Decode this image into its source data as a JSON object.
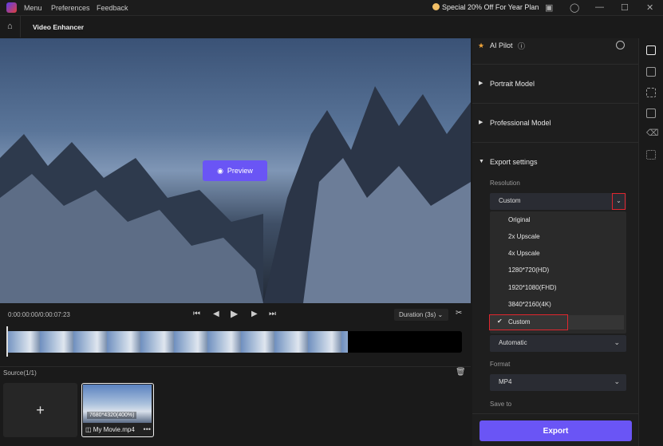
{
  "topbar": {
    "menu": "Menu",
    "preferences": "Preferences",
    "feedback": "Feedback",
    "promo": "Special 20% Off For Year Plan"
  },
  "header": {
    "title": "Video Enhancer"
  },
  "preview": {
    "label": "Preview"
  },
  "player": {
    "time": "0:00:00:00/0:00:07:23",
    "duration": "Duration (3s)"
  },
  "source": {
    "label": "Source(1/1)",
    "add": "+",
    "file": {
      "resolution": "7680*4320(400%)",
      "name": "My Movie.mp4"
    }
  },
  "panel": {
    "ai_pilot": "AI Pilot",
    "portrait": "Portrait Model",
    "professional": "Professional Model",
    "export_settings": "Export settings",
    "resolution_label": "Resolution",
    "resolution_value": "Custom",
    "resolution_options": [
      "Original",
      "2x Upscale",
      "4x Upscale",
      "1280*720(HD)",
      "1920*1080(FHD)",
      "3840*2160(4K)",
      "Custom"
    ],
    "second_value": "Automatic",
    "format_label": "Format",
    "format_value": "MP4",
    "save_label": "Save to",
    "export": "Export"
  },
  "colors": {
    "accent": "#6a55f5",
    "highlight": "#e0262e"
  }
}
